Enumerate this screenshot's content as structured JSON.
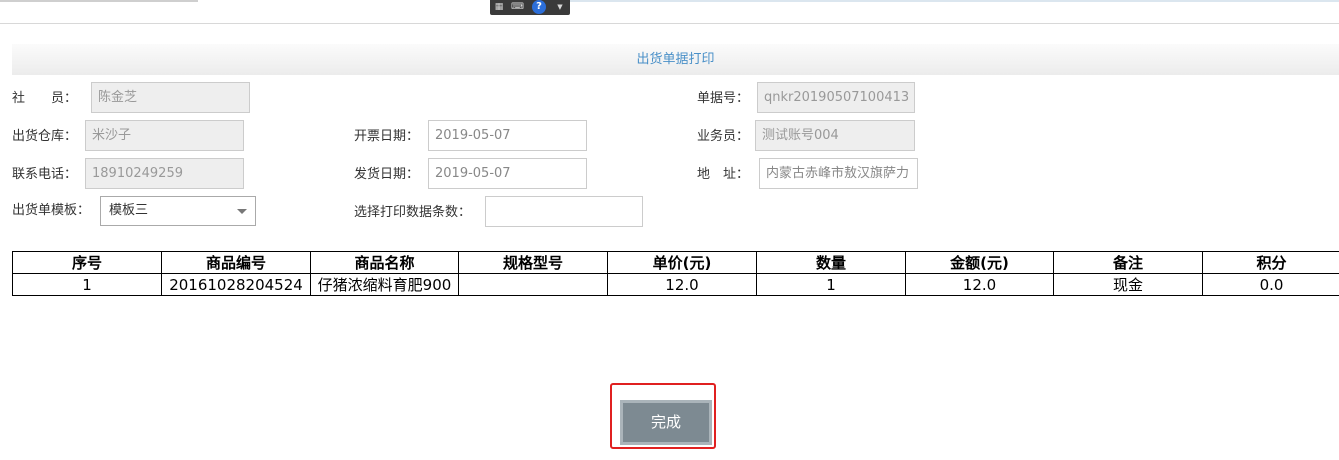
{
  "toolbar": {
    "grid_icon": "grid-icon",
    "keyboard_icon": "keyboard-icon",
    "help_icon": "help-icon",
    "dropdown_icon": "chevron-down-icon"
  },
  "page_title": "出货单据打印",
  "form": {
    "member_label": "社　　员：",
    "member_value": "陈金芝",
    "doc_no_label": "单据号：",
    "doc_no_value": "qnkr20190507100413",
    "warehouse_label": "出货仓库：",
    "warehouse_value": "米沙子",
    "invoice_date_label": "开票日期：",
    "invoice_date_value": "2019-05-07",
    "salesperson_label": "业务员：",
    "salesperson_value": "测试账号004",
    "phone_label": "联系电话：",
    "phone_value": "18910249259",
    "ship_date_label": "发货日期：",
    "ship_date_value": "2019-05-07",
    "address_label": "地　址：",
    "address_value": "内蒙古赤峰市敖汉旗萨力",
    "template_label": "出货单模板：",
    "template_value": "模板三",
    "print_count_label": "选择打印数据条数：",
    "print_count_value": ""
  },
  "table": {
    "headers": [
      "序号",
      "商品编号",
      "商品名称",
      "规格型号",
      "单价(元)",
      "数量",
      "金额(元)",
      "备注",
      "积分"
    ],
    "rows": [
      [
        "1",
        "20161028204524",
        "仔猪浓缩料育肥900",
        "",
        "12.0",
        "1",
        "12.0",
        "现金",
        "0.0"
      ]
    ]
  },
  "finish_button": "完成",
  "colors": {
    "title_text": "#4a90c8",
    "highlight_border": "#e02020",
    "button_bg": "#7d8a92"
  }
}
